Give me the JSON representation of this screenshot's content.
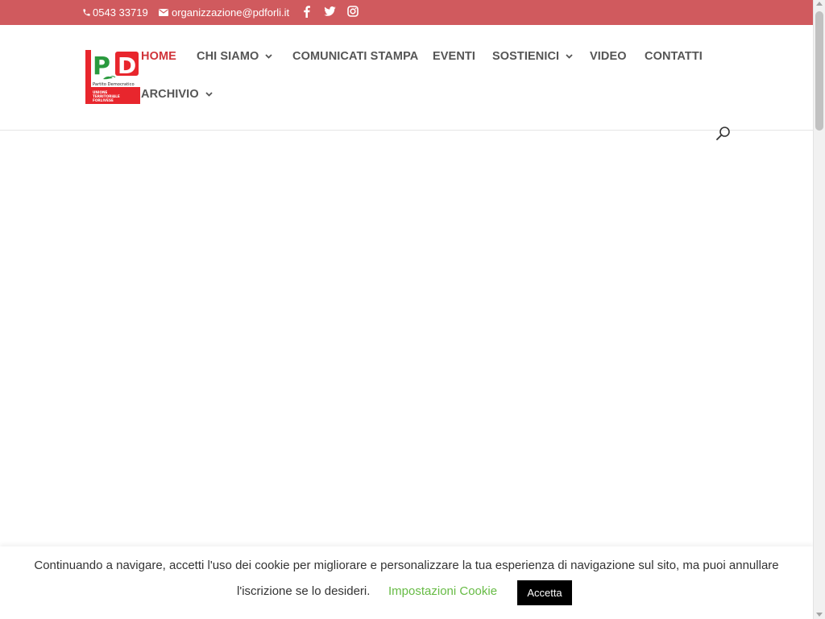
{
  "topbar": {
    "phone": "0543 33719",
    "email": "organizzazione@pdforli.it",
    "background": "#d05a5e",
    "social": [
      "facebook-icon",
      "twitter-icon",
      "instagram-icon"
    ]
  },
  "logo": {
    "alt": "Partito Democratico",
    "brand_letters": "PD",
    "line1": "Partito Democratico",
    "line2": "UNIONE TERRITORIALE FORLIVESE"
  },
  "nav": {
    "items": [
      {
        "label": "HOME",
        "active": true,
        "has_submenu": false
      },
      {
        "label": "CHI SIAMO",
        "active": false,
        "has_submenu": true
      },
      {
        "label": "COMUNICATI STAMPA",
        "active": false,
        "has_submenu": false
      },
      {
        "label": "EVENTI",
        "active": false,
        "has_submenu": false
      },
      {
        "label": "SOSTIENICI",
        "active": false,
        "has_submenu": true
      },
      {
        "label": "VIDEO",
        "active": false,
        "has_submenu": false
      },
      {
        "label": "CONTATTI",
        "active": false,
        "has_submenu": false
      },
      {
        "label": "ARCHIVIO",
        "active": false,
        "has_submenu": true
      }
    ],
    "active_color": "#d0343a",
    "color": "#555555"
  },
  "cookie": {
    "text_line1": "Continuando a navigare, accetti l'uso dei cookie per migliorare e personalizzare la tua esperienza di navigazione sul sito, ma puoi annullare",
    "text_line2": "l'iscrizione se lo desideri.",
    "settings_label": "Impostazioni Cookie",
    "accept_label": "Accetta",
    "settings_color": "#66bb44"
  }
}
